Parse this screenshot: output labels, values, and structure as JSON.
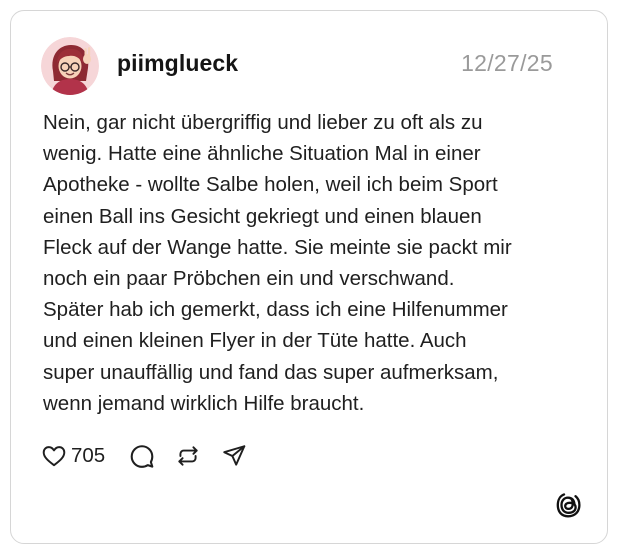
{
  "post": {
    "username": "piimglueck",
    "date": "12/27/25",
    "avatar_icon": "cartoon-avatar-icon",
    "lines": [
      "Nein, gar nicht übergriffig und lieber zu oft als zu",
      "wenig. Hatte eine ähnliche Situation Mal in einer",
      "Apotheke - wollte Salbe holen, weil ich beim Sport",
      "einen Ball ins Gesicht gekriegt und einen blauen",
      "Fleck auf der Wange hatte. Sie meinte sie packt mir",
      "noch ein paar Pröbchen ein und verschwand.",
      "Später hab ich gemerkt, dass ich eine Hilfenummer",
      "und einen kleinen Flyer in der Tüte hatte. Auch",
      "super unauffällig und fand das super aufmerksam,",
      "wenn jemand wirklich Hilfe braucht."
    ]
  },
  "actions": {
    "like_icon": "heart-icon",
    "like_count": "705",
    "reply_icon": "comment-icon",
    "repost_icon": "repost-icon",
    "share_icon": "send-icon"
  },
  "brand": {
    "logo_icon": "threads-logo-icon"
  },
  "colors": {
    "text": "#1f1f1f",
    "muted": "#9a9a9a",
    "border": "#d6d6d6",
    "avatar_bg": "#f6d6d8"
  }
}
